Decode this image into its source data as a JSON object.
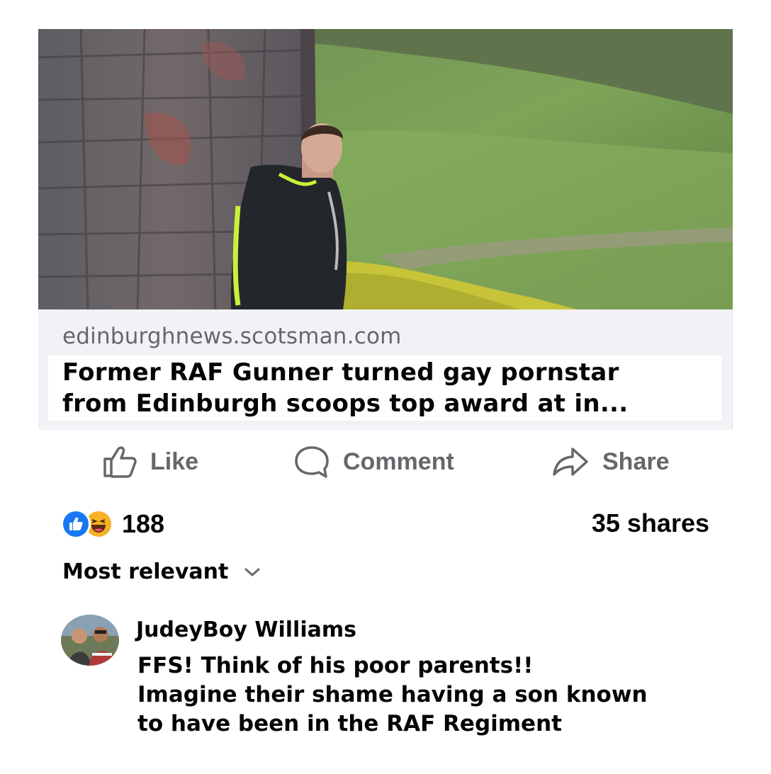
{
  "link_preview": {
    "image_icon": "photo-man-in-track-jacket-against-stone-wall-hillside",
    "domain": "edinburghnews.scotsman.com",
    "headline_line1": "Former RAF Gunner turned gay pornstar",
    "headline_line2": "from Edinburgh scoops top award at in..."
  },
  "actions": {
    "like_label": "Like",
    "comment_label": "Comment",
    "share_label": "Share"
  },
  "stats": {
    "reaction_icons": [
      "like-icon",
      "haha-icon"
    ],
    "reaction_count": "188",
    "shares": "35 shares"
  },
  "comments_sort": {
    "label": "Most relevant",
    "icon": "chevron-down-icon"
  },
  "comments": [
    {
      "author": "JudeyBoy Williams",
      "line1": "FFS! Think of his poor parents!!",
      "line2": "Imagine their shame having a son known",
      "line3": "to have been in the RAF Regiment"
    }
  ],
  "colors": {
    "text_primary": "#050505",
    "text_secondary": "#65676b",
    "like_blue": "#1877f2",
    "haha_yellow": "#f7b125",
    "card_bg": "#f0f2f5"
  }
}
